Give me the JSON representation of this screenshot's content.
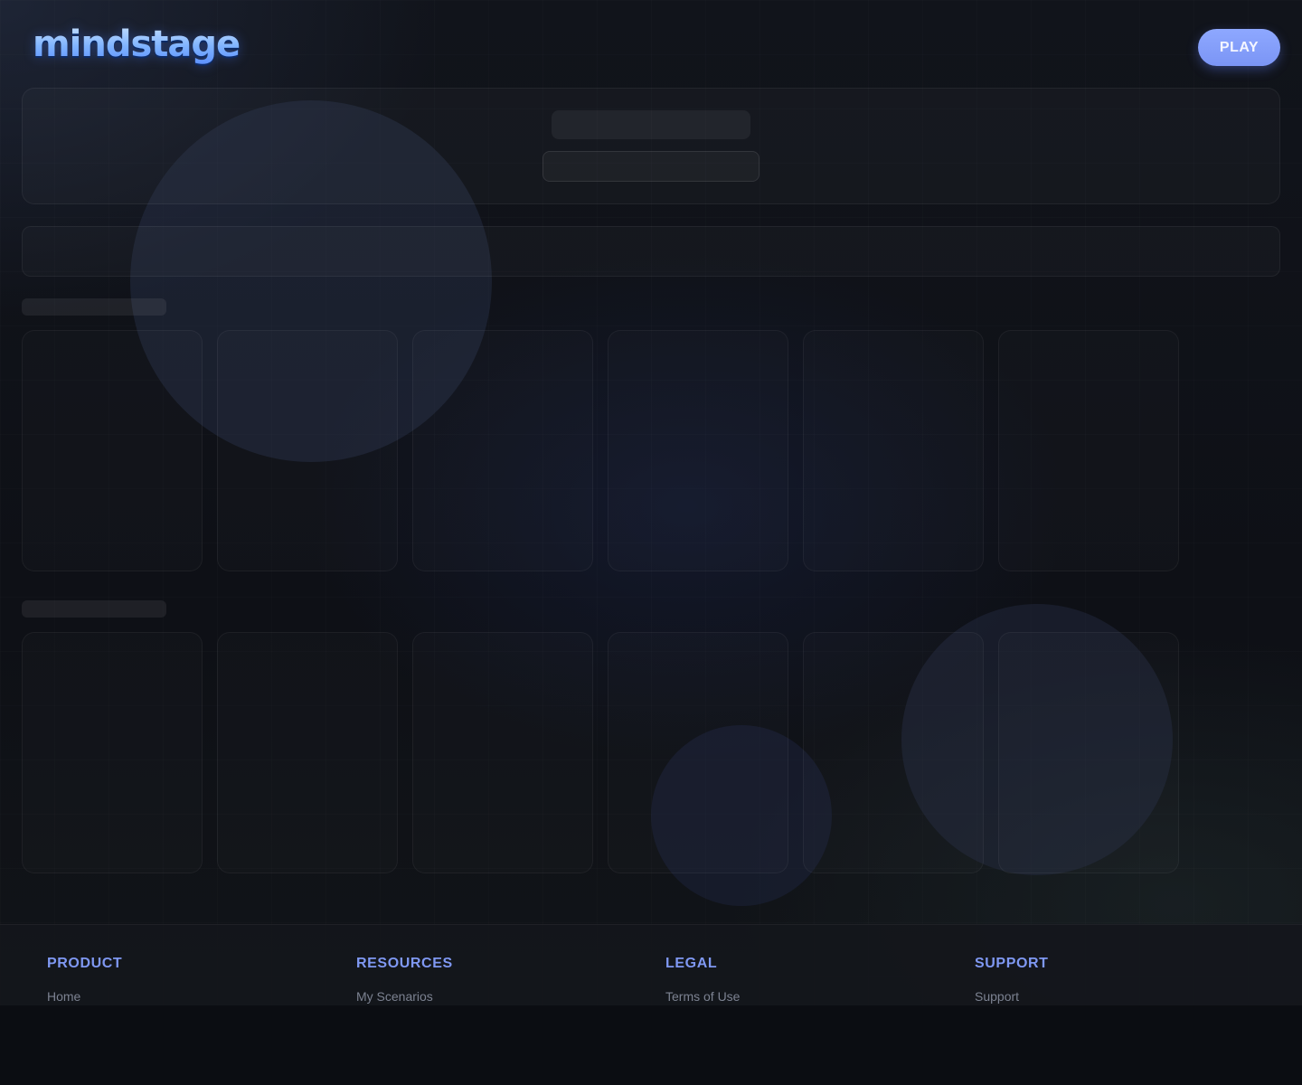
{
  "header": {
    "logo_text": "mindstage",
    "play_label": "PLAY"
  },
  "rows": [
    {
      "card_count": 6
    },
    {
      "card_count": 6
    }
  ],
  "footer": {
    "columns": [
      {
        "heading": "PRODUCT",
        "link": "Home"
      },
      {
        "heading": "RESOURCES",
        "link": "My Scenarios"
      },
      {
        "heading": "LEGAL",
        "link": "Terms of Use"
      },
      {
        "heading": "SUPPORT",
        "link": "Support"
      }
    ]
  },
  "colors": {
    "accent": "#7f98f2",
    "play_button": "#8ea8ff",
    "background": "#0b0d12"
  }
}
